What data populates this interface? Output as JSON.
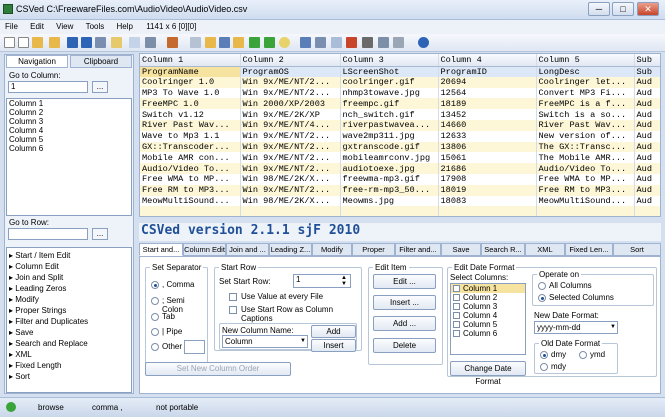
{
  "window": {
    "title": "CSVed C:\\FreewareFiles.com\\AudioVideo\\AudioVideo.csv",
    "min": "─",
    "max": "□",
    "close": "✕"
  },
  "menu": [
    "File",
    "Edit",
    "View",
    "Tools",
    "Help"
  ],
  "toolbar_info": "1141 x 6 [0][0]",
  "left": {
    "tabs": [
      "Navigation",
      "Clipboard"
    ],
    "goto_column_label": "Go to Column:",
    "goto_column_value": "1",
    "columns": [
      "Column 1",
      "Column 2",
      "Column 3",
      "Column 4",
      "Column 5",
      "Column 6"
    ],
    "goto_row_label": "Go to Row:",
    "goto_row_value": "",
    "tree": [
      "Start / Item Edit",
      "Column Edit",
      "Join and Split",
      "Leading Zeros",
      "Modify",
      "Proper Strings",
      "Filter and Duplicates",
      "Save",
      "Search and Replace",
      "XML",
      "Fixed Length",
      "Sort"
    ]
  },
  "grid": {
    "headers": [
      "Column 1",
      "Column 2",
      "Column 3",
      "Column 4",
      "Column 5",
      "Sub"
    ],
    "rows": [
      [
        "ProgramName",
        "ProgramOS",
        "LScreenShot",
        "ProgramID",
        "LongDesc",
        "Sub"
      ],
      [
        "Coolringer 1.0",
        "Win 9x/ME/NT/2...",
        "coolringer.gif",
        "20694",
        "Coolringer let...",
        "Aud"
      ],
      [
        "MP3 To Wave 1.0",
        "Win 9x/ME/NT/2...",
        "nhmp3towave.jpg",
        "12564",
        "Convert MP3 Fi...",
        "Aud"
      ],
      [
        "FreeMPC 1.0",
        "Win 2000/XP/2003",
        "freempc.gif",
        "18189",
        "FreeMPC is a f...",
        "Aud"
      ],
      [
        "Switch v1.12",
        "Win 9x/ME/2K/XP",
        "nch_switch.gif",
        "13452",
        "Switch is a so...",
        "Aud"
      ],
      [
        "River Past Wav...",
        "Win 9x/ME/NT/4...",
        "riverpastwavea...",
        "14660",
        "River Past Wav...",
        "Aud"
      ],
      [
        "Wave to Mp3 1.1",
        "Win 9x/ME/NT/2...",
        "wave2mp311.jpg",
        "12633",
        "New version of...",
        "Aud"
      ],
      [
        "GX::Transcoder...",
        "Win 9x/ME/NT/2...",
        "gxtranscode.gif",
        "13806",
        "The GX::Transc...",
        "Aud"
      ],
      [
        "Mobile AMR con...",
        "Win 9x/ME/NT/2...",
        "mobileamrconv.jpg",
        "15061",
        "The Mobile AMR...",
        "Aud"
      ],
      [
        "Audio/Video To...",
        "Win 9x/ME/NT/2...",
        "audiotoexe.jpg",
        "21686",
        "Audio/Video To...",
        "Aud"
      ],
      [
        "Free WMA to MP...",
        "Win 98/ME/2K/X...",
        "freewma-mp3.gif",
        "17908",
        "Free WMA to MP...",
        "Aud"
      ],
      [
        "Free RM to MP3...",
        "Win 9x/ME/NT/2...",
        "free-rm-mp3_50...",
        "18019",
        "Free RM to MP3...",
        "Aud"
      ],
      [
        "MeowMultiSound...",
        "Win 98/ME/2K/X...",
        "Meowms.jpg",
        "18083",
        "MeowMultiSound...",
        "Aud"
      ],
      [
        "",
        "",
        "",
        "",
        "",
        "",
        ""
      ]
    ]
  },
  "version": "CSVed version 2.1.1 sjF 2010",
  "tabs": [
    "Start and...",
    "Column Edit",
    "Join and ...",
    "Leading Z...",
    "Modify",
    "Proper",
    "Filter and...",
    "Save",
    "Search R...",
    "XML",
    "Fixed Len...",
    "Sort"
  ],
  "panel": {
    "separator": {
      "title": "Set Separator",
      "options": [
        ", Comma",
        "; Semi Colon",
        "Tab",
        "| Pipe",
        "Other"
      ],
      "selected": 0
    },
    "start_row": {
      "title": "Start Row",
      "label": "Set Start Row:",
      "value": "1",
      "chk1": "Use Value at every File",
      "chk2": "Use Start Row as Column Captions"
    },
    "new_column": {
      "title": "New Column Name:",
      "value": "Column",
      "add": "Add",
      "insert": "Insert"
    },
    "set_order": "Set New Column Order",
    "edit_item": {
      "title": "Edit Item",
      "edit": "Edit ...",
      "insert": "Insert ...",
      "add": "Add ...",
      "delete": "Delete"
    },
    "date": {
      "title": "Edit Date Format",
      "select": "Select Columns:",
      "columns": [
        "Column 1",
        "Column 2",
        "Column 3",
        "Column 4",
        "Column 5",
        "Column 6"
      ],
      "change": "Change Date Format",
      "operate_title": "Operate on",
      "all": "All Columns",
      "selected": "Selected Columns",
      "new_format_label": "New Date Format:",
      "new_format": "yyyy-mm-dd",
      "old_title": "Old Date Format",
      "dmy": "dmy",
      "ymd": "ymd",
      "mdy": "mdy"
    }
  },
  "status": {
    "mode": "browse",
    "sep": "comma ,",
    "portable": "not portable"
  }
}
